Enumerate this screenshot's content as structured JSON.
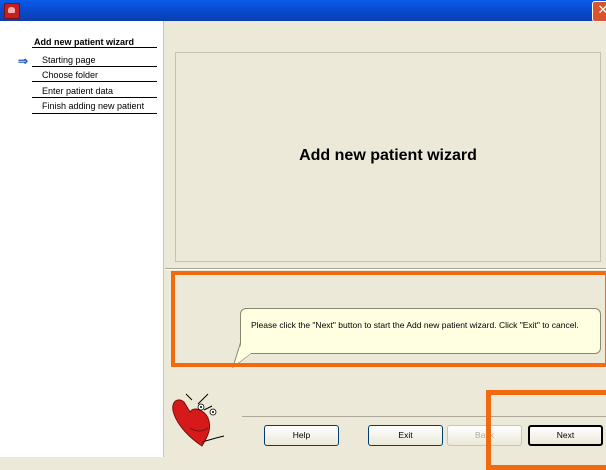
{
  "window": {
    "title": "",
    "close_glyph": "✕"
  },
  "sidebar": {
    "title": "Add new patient wizard",
    "current_arrow": "⇒",
    "items": [
      {
        "label": "Starting page"
      },
      {
        "label": "Choose folder"
      },
      {
        "label": "Enter patient data"
      },
      {
        "label": "Finish adding new patient"
      }
    ]
  },
  "main": {
    "title": "Add new patient wizard"
  },
  "hint": {
    "text": "Please click the \"Next\" button to start the Add new patient wizard. Click \"Exit\" to cancel."
  },
  "buttons": {
    "help": "Help",
    "exit": "Exit",
    "back": "Back",
    "next": "Next"
  },
  "colors": {
    "titlebar": "#0848c8",
    "highlight": "#f26a10",
    "bubble": "#ffffe1",
    "mascot": "#d61a1a"
  }
}
